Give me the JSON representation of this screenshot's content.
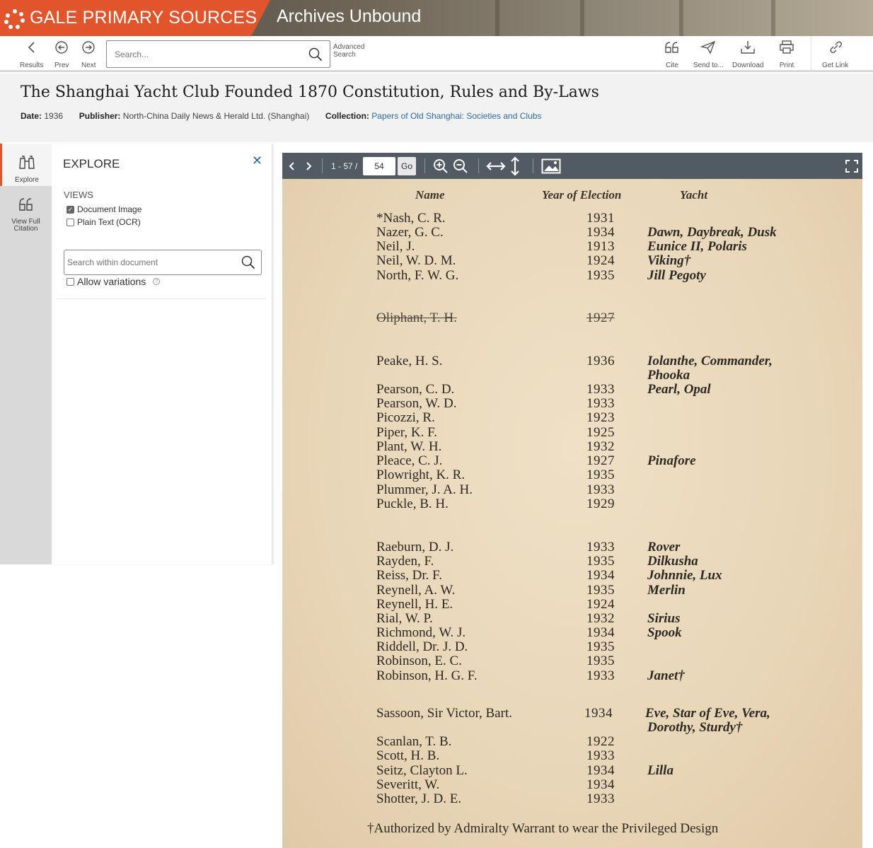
{
  "banner": {
    "brand": "GALE PRIMARY SOURCES",
    "product": "Archives Unbound",
    "brand_color": "#e2542b"
  },
  "toolbar": {
    "results_label": "Results",
    "prev_label": "Prev",
    "next_label": "Next",
    "search_placeholder": "Search...",
    "advanced_line1": "Advanced",
    "advanced_line2": "Search",
    "cite_label": "Cite",
    "send_label": "Send to...",
    "download_label": "Download",
    "print_label": "Print",
    "getlink_label": "Get Link"
  },
  "document": {
    "title": "The Shanghai Yacht Club Founded 1870 Constitution, Rules and By-Laws",
    "date_label": "Date:",
    "date": "1936",
    "publisher_label": "Publisher:",
    "publisher": "North-China Daily News & Herald Ltd. (Shanghai)",
    "collection_label": "Collection:",
    "collection": "Papers of Old Shanghai: Societies and Clubs",
    "link_color": "#2a6ca7"
  },
  "rail": {
    "explore_label": "Explore",
    "citation_line1": "View Full",
    "citation_line2": "Citation"
  },
  "explore": {
    "title": "EXPLORE",
    "views_heading": "VIEWS",
    "view_options": [
      {
        "label": "Document Image",
        "checked": true
      },
      {
        "label": "Plain Text (OCR)",
        "checked": false
      }
    ],
    "search_placeholder": "Search within document",
    "allow_variations_label": "Allow variations",
    "allow_variations_checked": false
  },
  "viewer": {
    "page_range": "1 - 57 /",
    "page_value": "54",
    "go_label": "Go",
    "toolbar_color": "#525a63"
  },
  "scan": {
    "col_name": "Name",
    "col_year": "Year of Election",
    "col_yacht": "Yacht",
    "rows": [
      {
        "name": "*Nash, C. R.",
        "year": "1931",
        "yacht": ""
      },
      {
        "name": "Nazer, G. C.",
        "year": "1934",
        "yacht": "Dawn, Daybreak, Dusk"
      },
      {
        "name": "Neil, J.",
        "year": "1913",
        "yacht": "Eunice II, Polaris"
      },
      {
        "name": "Neil, W. D. M.",
        "year": "1924",
        "yacht": "Viking†"
      },
      {
        "name": "North, F. W. G.",
        "year": "1935",
        "yacht": "Jill Pegoty"
      },
      {
        "name": "Oliphant, T. H.",
        "year": "1927",
        "yacht": "",
        "struck": true
      },
      {
        "name": "Peake, H. S.",
        "year": "1936",
        "yacht": "Iolanthe,  Commander,"
      },
      {
        "name": "",
        "year": "",
        "yacht": "Phooka"
      },
      {
        "name": "Pearson, C. D.",
        "year": "1933",
        "yacht": "Pearl, Opal"
      },
      {
        "name": "Pearson, W. D.",
        "year": "1933",
        "yacht": ""
      },
      {
        "name": "Picozzi, R.",
        "year": "1923",
        "yacht": ""
      },
      {
        "name": "Piper, K. F.",
        "year": "1925",
        "yacht": ""
      },
      {
        "name": "Plant, W. H.",
        "year": "1932",
        "yacht": ""
      },
      {
        "name": "Pleace, C. J.",
        "year": "1927",
        "yacht": "Pinafore"
      },
      {
        "name": "Plowright, K. R.",
        "year": "1935",
        "yacht": ""
      },
      {
        "name": "Plummer, J. A. H.",
        "year": "1933",
        "yacht": ""
      },
      {
        "name": "Puckle, B. H.",
        "year": "1929",
        "yacht": ""
      },
      {
        "name": "Raeburn, D. J.",
        "year": "1933",
        "yacht": "Rover"
      },
      {
        "name": "Rayden, F.",
        "year": "1935",
        "yacht": "Dilkusha"
      },
      {
        "name": "Reiss, Dr. F.",
        "year": "1934",
        "yacht": "Johnnie, Lux"
      },
      {
        "name": "Reynell, A. W.",
        "year": "1935",
        "yacht": "Merlin"
      },
      {
        "name": "Reynell, H. E.",
        "year": "1924",
        "yacht": ""
      },
      {
        "name": "Rial, W. P.",
        "year": "1932",
        "yacht": "Sirius"
      },
      {
        "name": "Richmond, W. J.",
        "year": "1934",
        "yacht": "Spook"
      },
      {
        "name": "Riddell, Dr. J. D.",
        "year": "1935",
        "yacht": ""
      },
      {
        "name": "Robinson, E. C.",
        "year": "1935",
        "yacht": ""
      },
      {
        "name": "Robinson, H. G. F.",
        "year": "1933",
        "yacht": "Janet†"
      },
      {
        "name": "Sassoon, Sir Victor, Bart.",
        "year": "1934",
        "yacht": "Eve, Star of Eve, Vera,"
      },
      {
        "name": "",
        "year": "",
        "yacht": "Dorothy, Sturdy†"
      },
      {
        "name": "Scanlan, T. B.",
        "year": "1922",
        "yacht": ""
      },
      {
        "name": "Scott, H. B.",
        "year": "1933",
        "yacht": ""
      },
      {
        "name": "Seitz, Clayton L.",
        "year": "1934",
        "yacht": "Lilla"
      },
      {
        "name": "Severitt, W.",
        "year": "1934",
        "yacht": ""
      },
      {
        "name": "Shotter, J. D. E.",
        "year": "1933",
        "yacht": ""
      }
    ],
    "footnote": "†Authorized by Admiralty Warrant to wear the Privileged Design"
  }
}
